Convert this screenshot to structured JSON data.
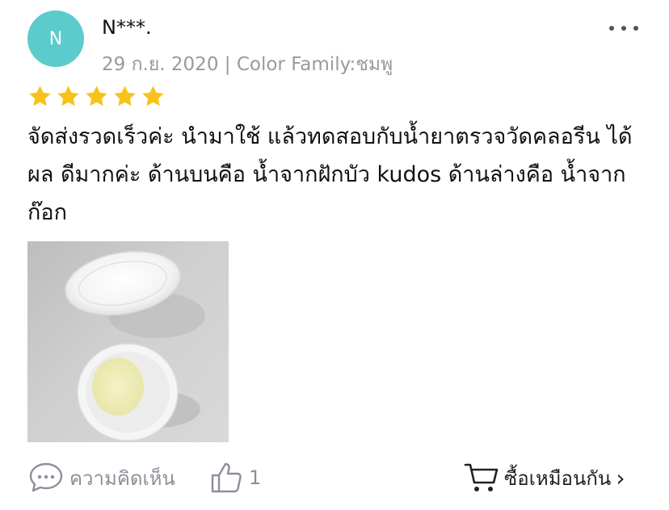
{
  "review": {
    "avatar_letter": "N",
    "username": "N***.",
    "date": "29 ก.ย. 2020",
    "separator": "|",
    "variant": "Color Family:ชมพู",
    "rating": 5,
    "text": "จัดส่งรวดเร็วค่ะ นำมาใช้ แล้วทดสอบกับน้ำยาตรวจวัดคลอรีน ได้\nผล ดีมากค่ะ ด้านบนคือ น้ำจากฝักบัว kudos ด้านล่างคือ น้ำจาก\nก๊อก"
  },
  "footer": {
    "comment_label": "ความคิดเห็น",
    "like_count": "1",
    "buy_label": "ซื้อเหมือนกัน",
    "buy_chevron": "›"
  },
  "icons": {
    "more": "more-dots-icon",
    "star": "star-icon",
    "comment": "chat-bubble-icon",
    "like": "thumbs-up-icon",
    "cart": "cart-icon"
  },
  "colors": {
    "avatar_bg": "#5ccbcc",
    "star": "#f7c31a",
    "meta_text": "#9a9a9a",
    "footer_text": "#8a8f99"
  }
}
